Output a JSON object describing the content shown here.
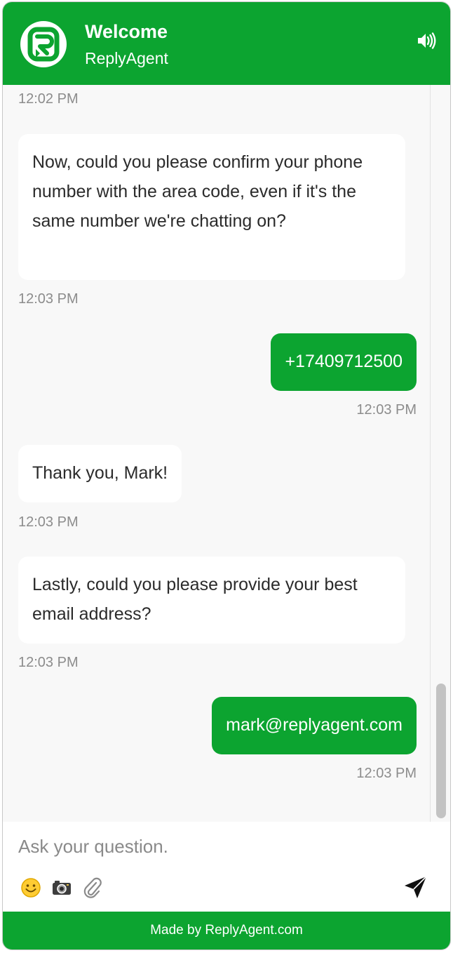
{
  "header": {
    "title": "Welcome",
    "subtitle": "ReplyAgent",
    "logo_icon": "replyagent-logo-icon",
    "sound_icon": "speaker-icon"
  },
  "messages": [
    {
      "sender": "bot",
      "time": "12:02 PM"
    },
    {
      "sender": "bot",
      "text": "Now, could you please confirm your phone number with the area code, even if it's the same number we're chatting on?",
      "time": "12:03 PM"
    },
    {
      "sender": "user",
      "text": "+17409712500",
      "time": "12:03 PM"
    },
    {
      "sender": "bot",
      "text": "Thank you, Mark!",
      "time": "12:03 PM"
    },
    {
      "sender": "bot",
      "text": "Lastly, could you please provide your best email address?",
      "time": "12:03 PM"
    },
    {
      "sender": "user",
      "text": "mark@replyagent.com",
      "time": "12:03 PM"
    }
  ],
  "composer": {
    "placeholder": "Ask your question.",
    "value": "",
    "tools": [
      "emoji-icon",
      "camera-icon",
      "paperclip-icon"
    ],
    "send_icon": "send-icon"
  },
  "footer": {
    "text": "Made by ReplyAgent.com"
  },
  "colors": {
    "brand": "#0ca430",
    "bot_bubble": "#ffffff",
    "background": "#f8f8f8",
    "timestamp": "#8c8c8c"
  }
}
